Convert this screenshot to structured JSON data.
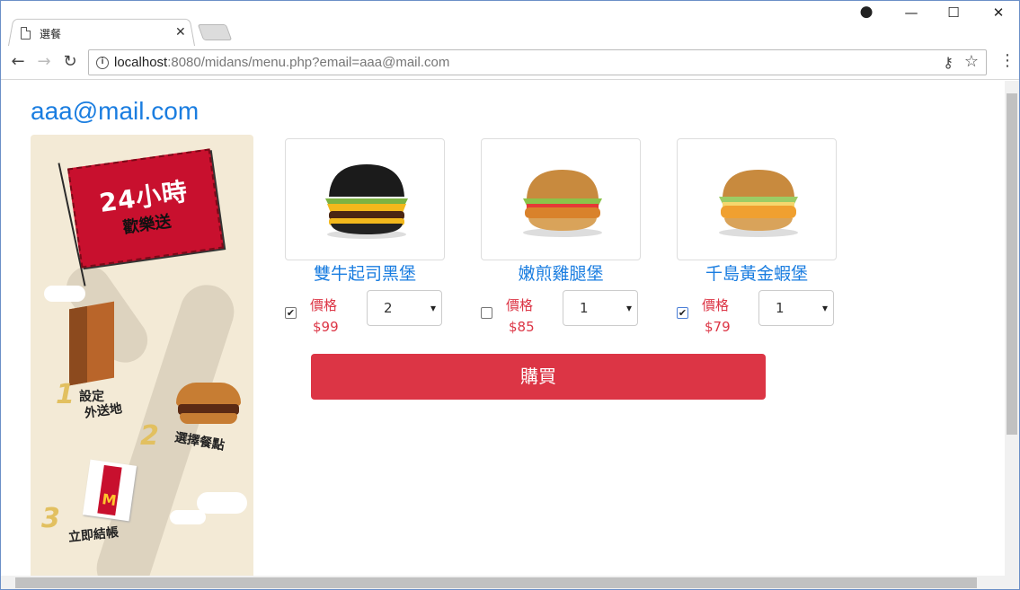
{
  "browser": {
    "tab_title": "選餐",
    "url_host": "localhost",
    "url_rest": ":8080/midans/menu.php?email=aaa@mail.com",
    "window_controls": [
      "minimize-icon",
      "maximize-icon",
      "close-icon"
    ]
  },
  "page": {
    "email": "aaa@mail.com",
    "banner": {
      "headline": "24小時",
      "subline": "歡樂送",
      "steps": [
        {
          "num": "1",
          "label_line1": "設定",
          "label_line2": "外送地"
        },
        {
          "num": "2",
          "label_line1": "選擇餐點",
          "label_line2": ""
        },
        {
          "num": "3",
          "label_line1": "立即結帳",
          "label_line2": ""
        }
      ],
      "bag_logo": "M"
    },
    "products": [
      {
        "name": "雙牛起司黑堡",
        "price_label": "價格",
        "price": "$99",
        "quantity": "2",
        "checked": true
      },
      {
        "name": "嫩煎雞腿堡",
        "price_label": "價格",
        "price": "$85",
        "quantity": "1",
        "checked": false
      },
      {
        "name": "千島黃金蝦堡",
        "price_label": "價格",
        "price": "$79",
        "quantity": "1",
        "checked": true
      }
    ],
    "buy_button": "購買"
  },
  "colors": {
    "accent": "#1a7de0",
    "buy": "#dc3545",
    "price": "#dc3545"
  }
}
